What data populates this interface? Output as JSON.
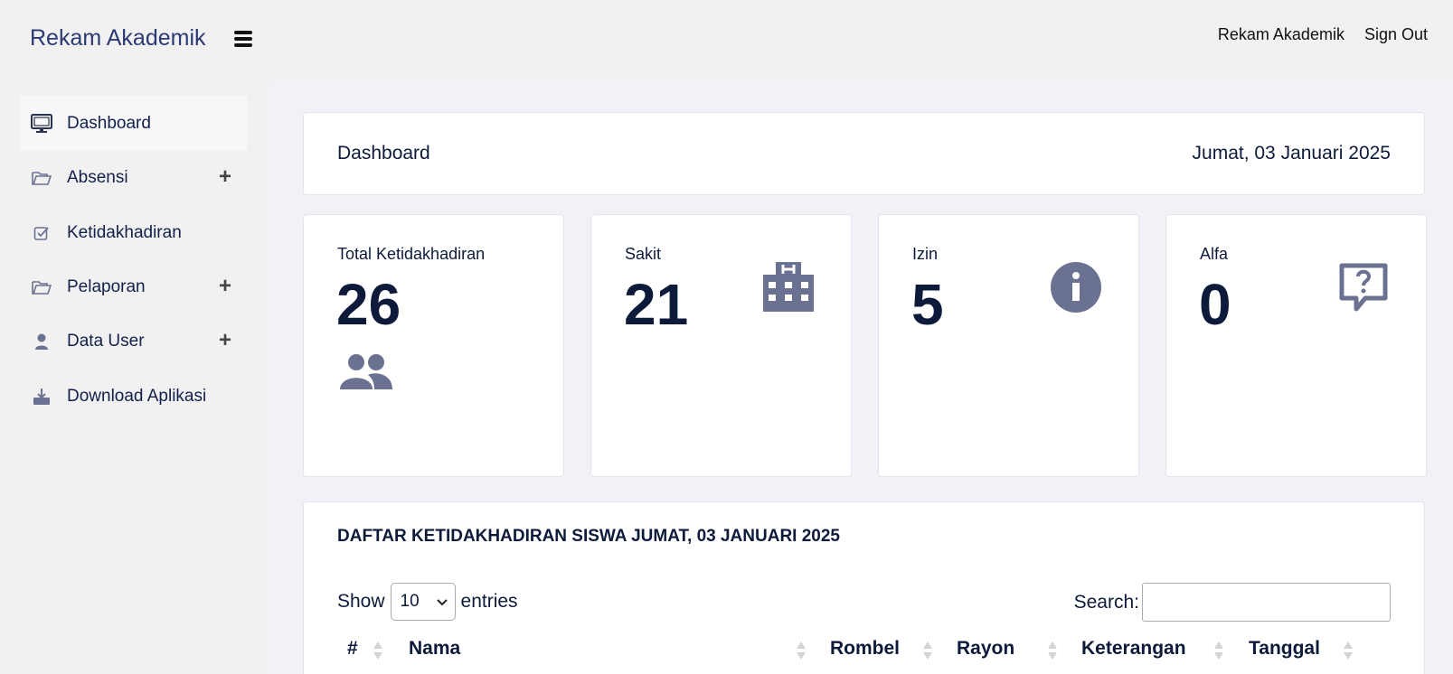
{
  "app": {
    "brand": "Rekam Akademik"
  },
  "topbar": {
    "user_link": "Rekam Akademik",
    "signout": "Sign Out"
  },
  "sidebar": {
    "items": [
      {
        "label": "Dashboard",
        "icon": "monitor-icon",
        "active": true,
        "expandable": false
      },
      {
        "label": "Absensi",
        "icon": "folder-icon",
        "expandable": true
      },
      {
        "label": "Ketidakhadiran",
        "icon": "check-square-icon",
        "expandable": false
      },
      {
        "label": "Pelaporan",
        "icon": "folder-icon",
        "expandable": true
      },
      {
        "label": "Data User",
        "icon": "user-icon",
        "expandable": true
      },
      {
        "label": "Download Aplikasi",
        "icon": "download-icon",
        "expandable": false
      }
    ],
    "plus": "+"
  },
  "header": {
    "title": "Dashboard",
    "date": "Jumat, 03 Januari 2025"
  },
  "stats": [
    {
      "label": "Total Ketidakhadiran",
      "value": "26",
      "icon": "users-icon"
    },
    {
      "label": "Sakit",
      "value": "21",
      "icon": "hospital-icon"
    },
    {
      "label": "Izin",
      "value": "5",
      "icon": "info-circle-icon"
    },
    {
      "label": "Alfa",
      "value": "0",
      "icon": "question-chat-icon"
    }
  ],
  "table": {
    "title": "DAFTAR KETIDAKHADIRAN SISWA JUMAT, 03 JANUARI 2025",
    "show_label": "Show",
    "entries_value": "10",
    "entries_label": "entries",
    "search_label": "Search:",
    "search_value": "",
    "columns": [
      "#",
      "Nama",
      "Rombel",
      "Rayon",
      "Keterangan",
      "Tanggal"
    ]
  },
  "colors": {
    "icon": "#6b7190",
    "text": "#0d1a3a",
    "brand": "#2b3a73"
  }
}
